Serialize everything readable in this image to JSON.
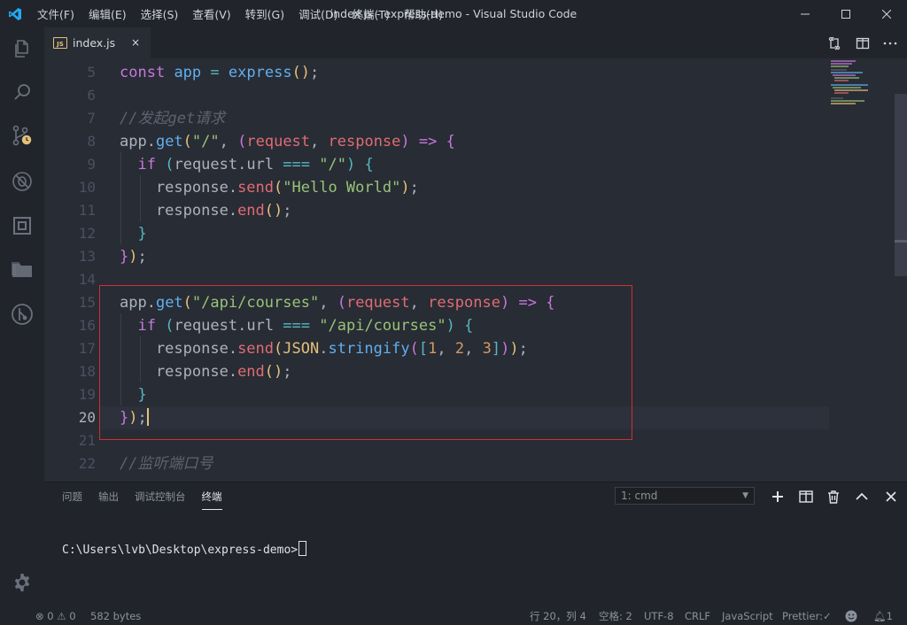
{
  "window": {
    "title": "index.js - express-demo - Visual Studio Code",
    "menu": [
      "文件(F)",
      "编辑(E)",
      "选择(S)",
      "查看(V)",
      "转到(G)",
      "调试(D)",
      "终端(T)",
      "帮助(H)"
    ]
  },
  "tab": {
    "filename": "index.js",
    "badge": "JS",
    "close": "×"
  },
  "editor": {
    "line_numbers": [
      "5",
      "6",
      "7",
      "8",
      "9",
      "10",
      "11",
      "12",
      "13",
      "14",
      "15",
      "16",
      "17",
      "18",
      "19",
      "20",
      "21",
      "22"
    ],
    "active_line": "20",
    "comment1": "//发起get请求",
    "comment2": "//监听端口号",
    "strings": {
      "root": "\"/\"",
      "hello": "\"Hello World\"",
      "courses": "\"/api/courses\""
    },
    "numbers": [
      "1",
      "2",
      "3"
    ]
  },
  "panel": {
    "tabs": [
      "问题",
      "输出",
      "调试控制台",
      "终端"
    ],
    "active_tab": "终端",
    "terminal_select": "1: cmd",
    "terminal_prompt": "C:\\Users\\lvb\\Desktop\\express-demo>"
  },
  "status": {
    "errors": "0",
    "warnings": "0",
    "filesize": "582 bytes",
    "position": "行 20，列 4",
    "spaces": "空格: 2",
    "encoding": "UTF-8",
    "eol": "CRLF",
    "language": "JavaScript",
    "prettier": "Prettier:",
    "notifications": "1"
  },
  "colors": {
    "background": "#282c34",
    "sidebar": "#21252b",
    "highlight_box": "#d12f2f",
    "vscode_blue": "#007acc"
  }
}
